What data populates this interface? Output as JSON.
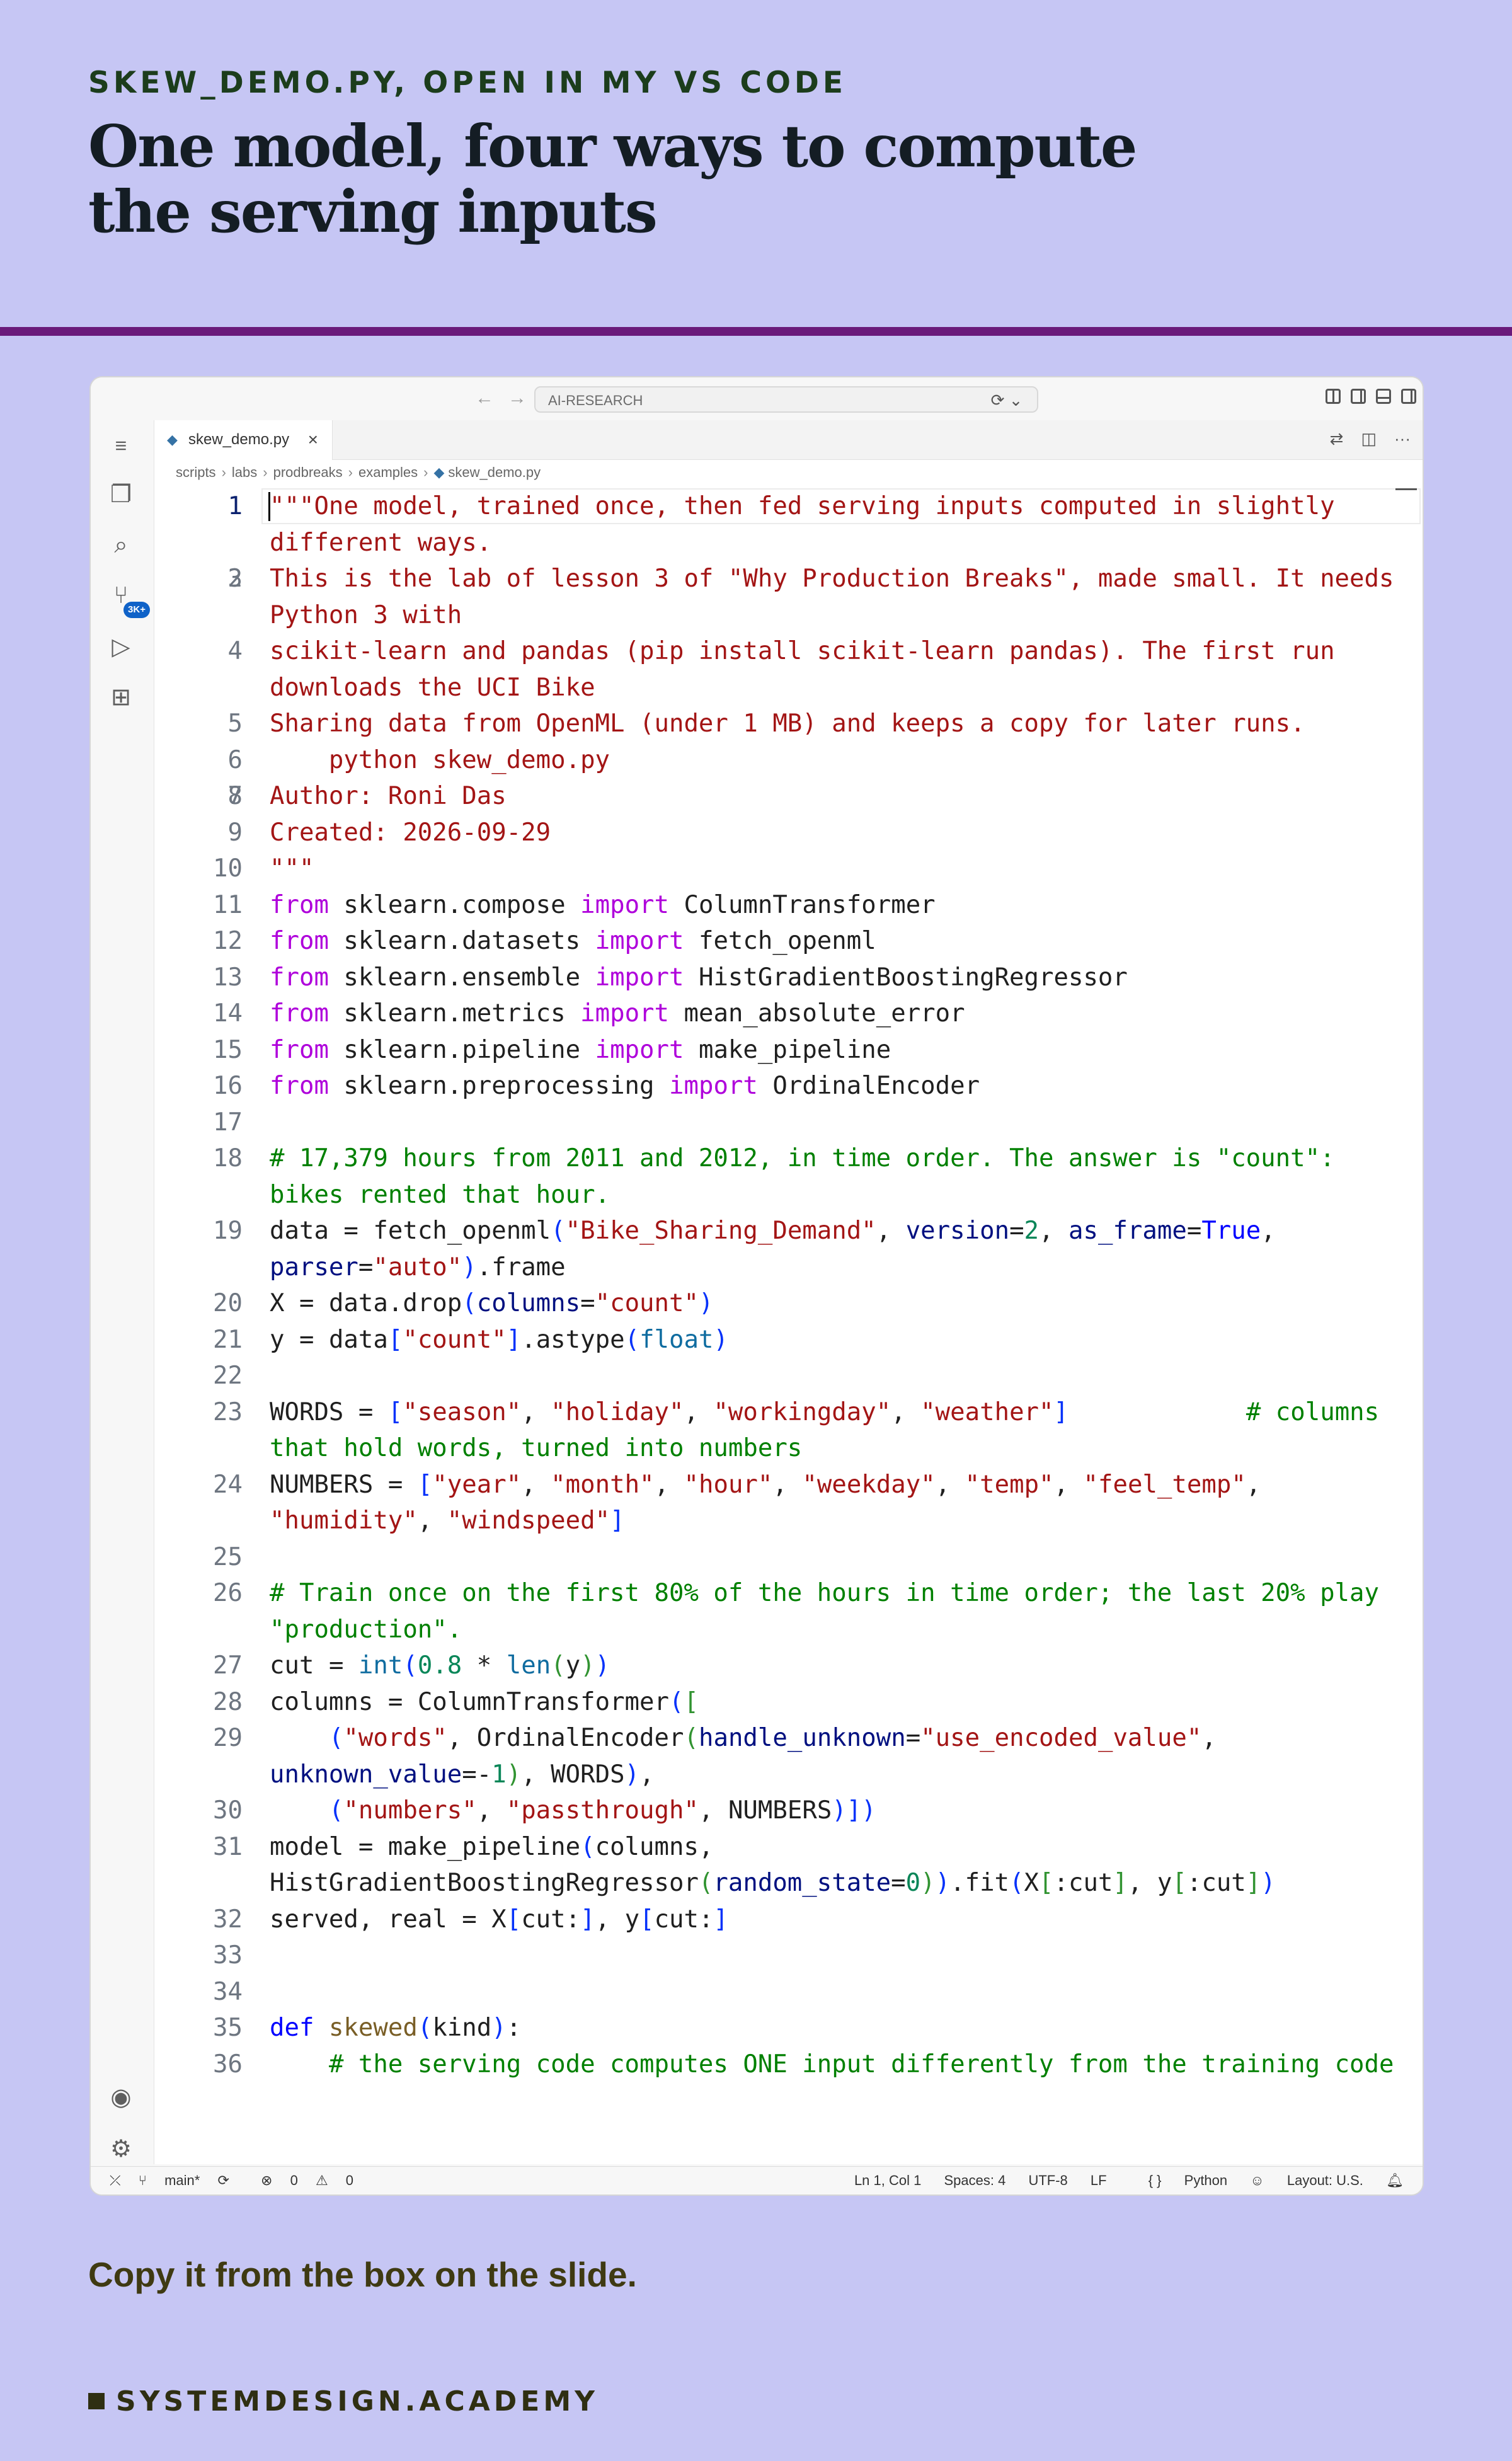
{
  "slide": {
    "kicker": "SKEW_DEMO.PY, OPEN IN MY VS CODE",
    "headline": "One model, four ways to compute the serving inputs",
    "footer_note": "Copy it from the box on the slide.",
    "brand": "SYSTEMDESIGN.ACADEMY"
  },
  "window": {
    "command_center": "AI-RESEARCH",
    "tab_label": "skew_demo.py",
    "breadcrumbs": [
      "scripts",
      "labs",
      "prodbreaks",
      "examples",
      "skew_demo.py"
    ],
    "scm_badge": "3K+"
  },
  "code": [
    {
      "n": "1",
      "t": "\"\"\"One model, trained once, then fed serving inputs computed in slightly different ways."
    },
    {
      "n": "2",
      "t": ""
    },
    {
      "n": "3",
      "t": "This is the lab of lesson 3 of \"Why Production Breaks\", made small. It needs Python 3 with"
    },
    {
      "n": "4",
      "t": "scikit-learn and pandas (pip install scikit-learn pandas). The first run downloads the UCI Bike"
    },
    {
      "n": "5",
      "t": "Sharing data from OpenML (under 1 MB) and keeps a copy for later runs."
    },
    {
      "n": "6",
      "t": "    python skew_demo.py"
    },
    {
      "n": "7",
      "t": ""
    },
    {
      "n": "8",
      "t": "Author: Roni Das"
    },
    {
      "n": "9",
      "t": "Created: 2026-09-29"
    },
    {
      "n": "10",
      "t": "\"\"\""
    },
    {
      "n": "11",
      "t": "from sklearn.compose import ColumnTransformer"
    },
    {
      "n": "12",
      "t": "from sklearn.datasets import fetch_openml"
    },
    {
      "n": "13",
      "t": "from sklearn.ensemble import HistGradientBoostingRegressor"
    },
    {
      "n": "14",
      "t": "from sklearn.metrics import mean_absolute_error"
    },
    {
      "n": "15",
      "t": "from sklearn.pipeline import make_pipeline"
    },
    {
      "n": "16",
      "t": "from sklearn.preprocessing import OrdinalEncoder"
    },
    {
      "n": "17",
      "t": ""
    },
    {
      "n": "18",
      "t": "# 17,379 hours from 2011 and 2012, in time order. The answer is \"count\": bikes rented that hour."
    },
    {
      "n": "19",
      "t": "data = fetch_openml(\"Bike_Sharing_Demand\", version=2, as_frame=True, parser=\"auto\").frame"
    },
    {
      "n": "20",
      "t": "X = data.drop(columns=\"count\")"
    },
    {
      "n": "21",
      "t": "y = data[\"count\"].astype(float)"
    },
    {
      "n": "22",
      "t": ""
    },
    {
      "n": "23",
      "t": "WORDS = [\"season\", \"holiday\", \"workingday\", \"weather\"]            # columns that hold words, turned into numbers"
    },
    {
      "n": "24",
      "t": "NUMBERS = [\"year\", \"month\", \"hour\", \"weekday\", \"temp\", \"feel_temp\", \"humidity\", \"windspeed\"]"
    },
    {
      "n": "25",
      "t": ""
    },
    {
      "n": "26",
      "t": "# Train once on the first 80% of the hours in time order; the last 20% play \"production\"."
    },
    {
      "n": "27",
      "t": "cut = int(0.8 * len(y))"
    },
    {
      "n": "28",
      "t": "columns = ColumnTransformer(["
    },
    {
      "n": "29",
      "t": "    (\"words\", OrdinalEncoder(handle_unknown=\"use_encoded_value\", unknown_value=-1), WORDS),"
    },
    {
      "n": "30",
      "t": "    (\"numbers\", \"passthrough\", NUMBERS)])"
    },
    {
      "n": "31",
      "t": "model = make_pipeline(columns, HistGradientBoostingRegressor(random_state=0)).fit(X[:cut], y[:cut])"
    },
    {
      "n": "32",
      "t": "served, real = X[cut:], y[cut:]"
    },
    {
      "n": "33",
      "t": ""
    },
    {
      "n": "34",
      "t": ""
    },
    {
      "n": "35",
      "t": "def skewed(kind):"
    },
    {
      "n": "36",
      "t": "    # the serving code computes ONE input differently from the training code"
    }
  ],
  "status": {
    "branch": "main*",
    "problems": "0",
    "warnings": "0",
    "position": "Ln 1, Col 1",
    "spaces": "Spaces: 4",
    "encoding": "UTF-8",
    "eol": "LF",
    "language": "Python",
    "layout": "Layout: U.S."
  }
}
